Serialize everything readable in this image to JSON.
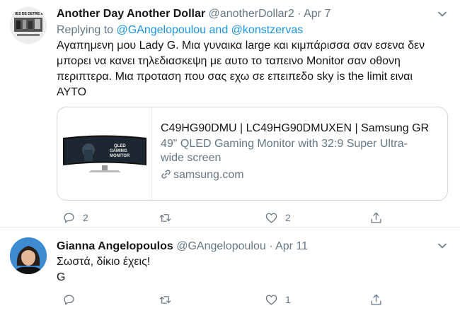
{
  "tweet1": {
    "name": "Another Day Another Dollar",
    "handle": "@anotherDollar2",
    "separator": "·",
    "date": "Apr 7",
    "replying_prefix": "Replying to",
    "replying_user1": "@GAngelopoulou",
    "replying_and": "and",
    "replying_user2": "@konstzervas",
    "text_lines": [
      "Αγαπημενη μου Lady G. Μια γυναικα large και κιμπάρισσα σαν εσενα δεν",
      "μπορει να κανει τηλεδιασκεψη με αυτο το ταπεινο Monitor σαν οθονη",
      "περιπτερα. Μια προταση που σας εχω σε επειπεδο sky is the limit ειναι",
      "ΑΥΤΟ"
    ],
    "avatar_text": "YOUS ÊNTES DE DETRE AMERLON",
    "card": {
      "title": "C49HG90DMU | LC49HG90DMUXEN | Samsung GR",
      "desc_lines": [
        "49\" QLED Gaming Monitor with 32:9 Super Ultra-",
        "wide screen"
      ],
      "domain": "samsung.com",
      "monitor_caption": "QLED GAMING MONITOR",
      "brand": "SAMSUNG"
    },
    "actions": {
      "reply_count": "2",
      "retweet_count": "",
      "like_count": "2"
    }
  },
  "tweet2": {
    "name": "Gianna Angelopoulos",
    "handle": "@GAngelopoulou",
    "separator": "·",
    "date": "Apr 11",
    "text_lines": [
      "Σωστά, δίκιο έχεις!",
      "G"
    ],
    "actions": {
      "reply_count": "",
      "retweet_count": "",
      "like_count": "1"
    }
  },
  "icons": {
    "caret": "chevron-down-icon",
    "reply": "reply-icon",
    "retweet": "retweet-icon",
    "like": "heart-icon",
    "share": "share-icon",
    "link": "link-icon"
  },
  "colors": {
    "accent": "#1b95e0",
    "secondary_text": "#657786",
    "border": "#e6ecf0"
  }
}
